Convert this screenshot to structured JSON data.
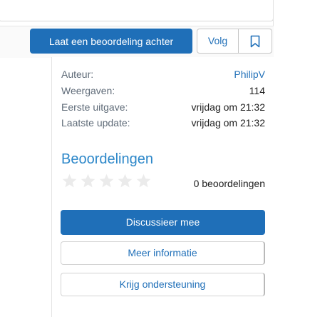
{
  "actions": {
    "review_label": "Laat een beoordeling achter",
    "follow_label": "Volg",
    "bookmark_icon": "bookmark-icon"
  },
  "meta": [
    {
      "label": "Auteur:",
      "value": "PhilipV",
      "link": true
    },
    {
      "label": "Weergaven:",
      "value": "114",
      "link": false
    },
    {
      "label": "Eerste uitgave:",
      "value": "vrijdag om 21:32",
      "link": false
    },
    {
      "label": "Laatste update:",
      "value": "vrijdag om 21:32",
      "link": false
    }
  ],
  "ratings": {
    "title": "Beoordelingen",
    "star_count": 5,
    "filled_stars": 0,
    "count_label": "0 beoordelingen"
  },
  "buttons": {
    "discuss_label": "Discussieer mee",
    "more_info_label": "Meer informatie",
    "support_label": "Krijg ondersteuning"
  },
  "colors": {
    "primary": "#1f6fb8",
    "accent_title": "#2c87c9",
    "star_empty": "#ebebeb"
  }
}
